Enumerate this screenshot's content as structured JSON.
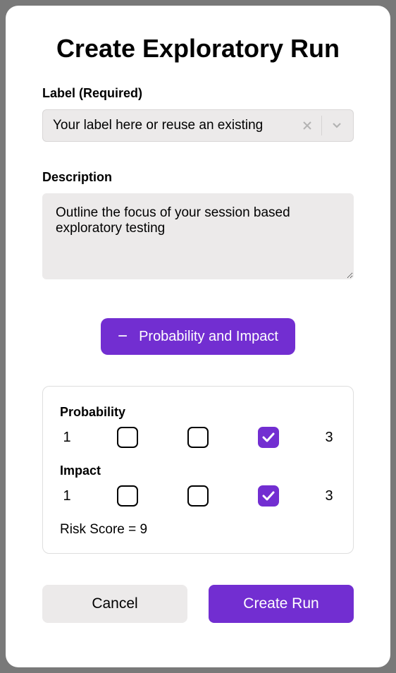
{
  "title": "Create Exploratory Run",
  "label_field": {
    "label": "Label (Required)",
    "placeholder": "Your label here or reuse an existing"
  },
  "description_field": {
    "label": "Description",
    "placeholder": "Outline the focus of your session based exploratory testing"
  },
  "toggle_button": {
    "label": "Probability and Impact"
  },
  "probability": {
    "label": "Probability",
    "min": "1",
    "max": "3",
    "selected_index": 2
  },
  "impact": {
    "label": "Impact",
    "min": "1",
    "max": "3",
    "selected_index": 2
  },
  "risk_score_text": "Risk Score = 9",
  "actions": {
    "cancel": "Cancel",
    "submit": "Create Run"
  },
  "colors": {
    "accent": "#722ed1"
  }
}
